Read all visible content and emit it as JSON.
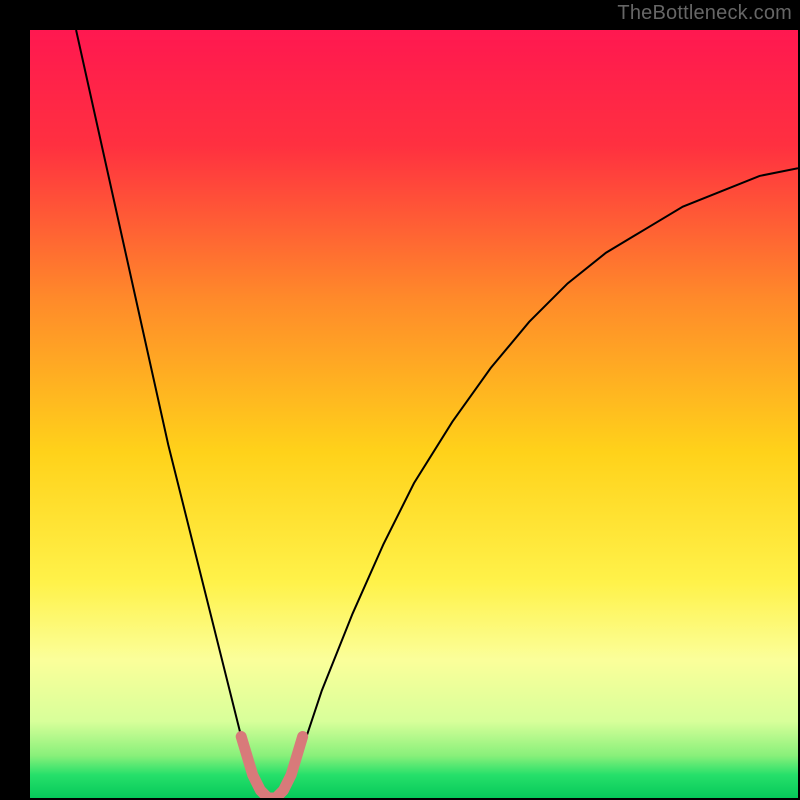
{
  "watermark": "TheBottleneck.com",
  "chart_data": {
    "type": "line",
    "title": "",
    "xlabel": "",
    "ylabel": "",
    "xlim": [
      0,
      100
    ],
    "ylim": [
      0,
      100
    ],
    "grid": false,
    "legend": null,
    "background_gradient": {
      "stops": [
        {
          "offset": 0.0,
          "color": "#ff1850"
        },
        {
          "offset": 0.15,
          "color": "#ff3040"
        },
        {
          "offset": 0.35,
          "color": "#ff8a2a"
        },
        {
          "offset": 0.55,
          "color": "#ffd21a"
        },
        {
          "offset": 0.72,
          "color": "#fff24a"
        },
        {
          "offset": 0.82,
          "color": "#fbff9a"
        },
        {
          "offset": 0.9,
          "color": "#d8ff9a"
        },
        {
          "offset": 0.945,
          "color": "#88f07a"
        },
        {
          "offset": 0.97,
          "color": "#26e06a"
        },
        {
          "offset": 1.0,
          "color": "#06c95a"
        }
      ]
    },
    "series": [
      {
        "name": "bottleneck-curve",
        "stroke": "#000000",
        "stroke_width": 2,
        "x": [
          6,
          8,
          10,
          12,
          14,
          16,
          18,
          20,
          22,
          24,
          26,
          27.5,
          29,
          30,
          31,
          32,
          33,
          34,
          36,
          38,
          42,
          46,
          50,
          55,
          60,
          65,
          70,
          75,
          80,
          85,
          90,
          95,
          100
        ],
        "y": [
          100,
          91,
          82,
          73,
          64,
          55,
          46,
          38,
          30,
          22,
          14,
          8,
          3,
          1,
          0,
          0,
          1,
          3,
          8,
          14,
          24,
          33,
          41,
          49,
          56,
          62,
          67,
          71,
          74,
          77,
          79,
          81,
          82
        ]
      },
      {
        "name": "optimal-zone-marker",
        "stroke": "#d87a7a",
        "stroke_width": 11,
        "linecap": "round",
        "x": [
          27.5,
          29,
          30,
          31,
          32,
          33,
          34,
          35.5
        ],
        "y": [
          8,
          3,
          1,
          0,
          0,
          1,
          3,
          8
        ]
      }
    ],
    "annotations": []
  }
}
